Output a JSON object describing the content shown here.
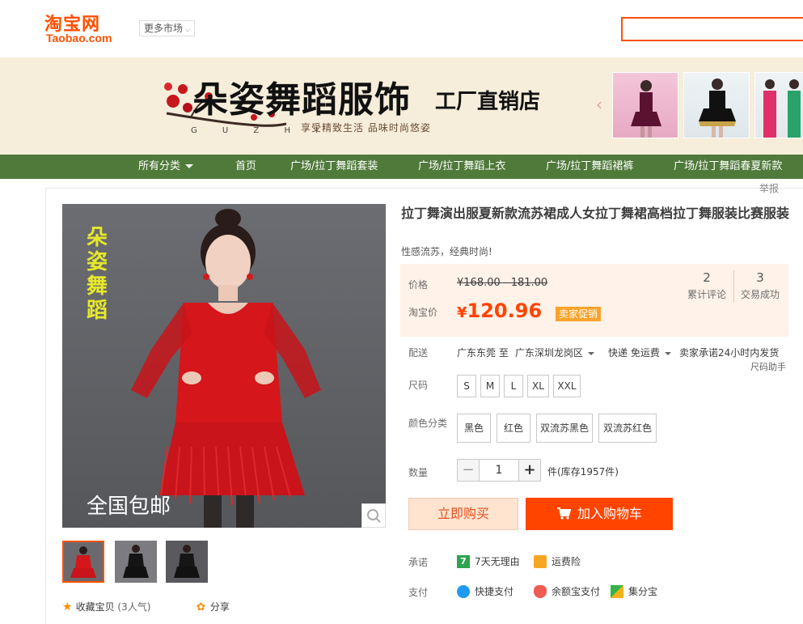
{
  "header": {
    "logo_cn": "淘宝网",
    "logo_en": "Taobao.com",
    "more_market": "更多市场"
  },
  "banner": {
    "title": "朵姿舞蹈服饰",
    "subtitle": "工厂直销店",
    "slogan": "享受精致生活  品味时尚悠姿",
    "letters": "G U Z H I"
  },
  "nav": {
    "items": [
      {
        "label": "所有分类",
        "has_caret": true
      },
      {
        "label": "首页"
      },
      {
        "label": "广场/拉丁舞蹈套装"
      },
      {
        "label": "广场/拉丁舞蹈上衣"
      },
      {
        "label": "广场/拉丁舞蹈裙裤"
      },
      {
        "label": "广场/拉丁舞蹈春夏新款"
      }
    ]
  },
  "report_link": "举报",
  "gallery": {
    "watermark_brand": "朵姿舞蹈",
    "free_shipping": "全国包邮",
    "active_thumb": 0
  },
  "favorites": {
    "label": "收藏宝贝",
    "count_text": "(3人气)"
  },
  "share": {
    "label": "分享"
  },
  "product": {
    "title": "拉丁舞演出服夏新款流苏裙成人女拉丁舞裙高档拉丁舞服装比赛服装",
    "subtitle": "性感流苏，经典时尚!"
  },
  "price": {
    "orig_label": "价格",
    "orig_price": "¥168.00 - 181.00",
    "tb_label": "淘宝价",
    "currency": "¥",
    "tb_price": "120.96",
    "promo_tag": "卖家促销",
    "stats": [
      {
        "value": "2",
        "label": "累计评论"
      },
      {
        "value": "3",
        "label": "交易成功"
      }
    ]
  },
  "delivery": {
    "label": "配送",
    "from": "广东东莞 至",
    "to": "广东深圳龙岗区",
    "method": "快递 免运费",
    "promise": "卖家承诺24小时内发货"
  },
  "size": {
    "label": "尺码",
    "helper": "尺码助手",
    "options": [
      "S",
      "M",
      "L",
      "XL",
      "XXL"
    ]
  },
  "color": {
    "label": "颜色分类",
    "options": [
      "黑色",
      "红色",
      "双流苏黑色",
      "双流苏红色"
    ]
  },
  "quantity": {
    "label": "数量",
    "value": "1",
    "minus": "−",
    "plus": "+",
    "stock_text": "件(库存1957件)"
  },
  "actions": {
    "buy_now": "立即购买",
    "add_cart": "加入购物车"
  },
  "promise": {
    "label": "承诺",
    "items": [
      "7天无理由",
      "运费险"
    ]
  },
  "payment": {
    "label": "支付",
    "items": [
      "快捷支付",
      "余额宝支付",
      "集分宝"
    ]
  },
  "colors": {
    "accent": "#ff5000",
    "price": "#ff4400",
    "nav_bg": "#4f7a3a",
    "banner_bg": "#f6edda",
    "price_panel_bg": "#fff2e8"
  }
}
